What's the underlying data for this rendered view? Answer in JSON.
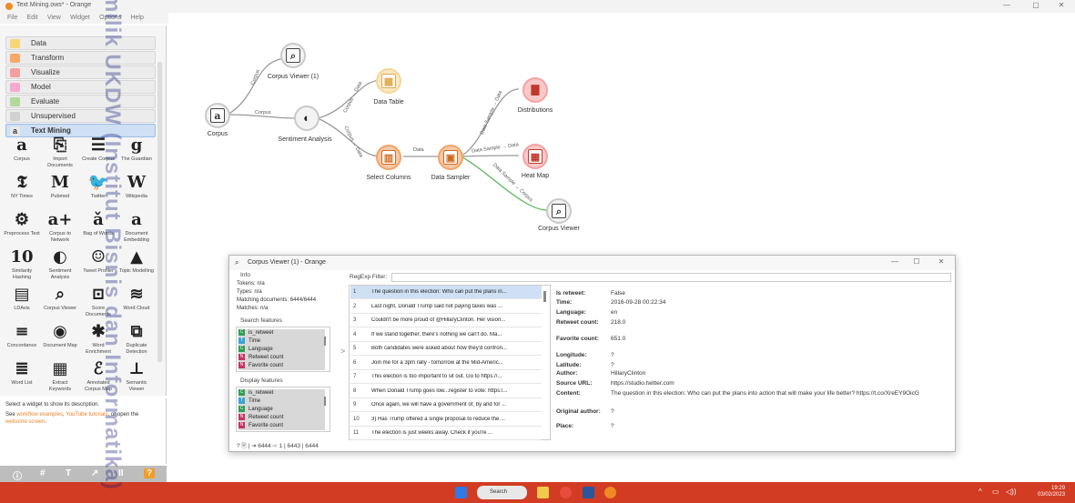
{
  "window": {
    "title": "Text Mining.ows* - Orange",
    "menu": [
      "File",
      "Edit",
      "View",
      "Widget",
      "Options",
      "Help"
    ]
  },
  "toolbox": {
    "categories": [
      {
        "label": "Data",
        "color": "#f7d775"
      },
      {
        "label": "Transform",
        "color": "#f7a96c"
      },
      {
        "label": "Visualize",
        "color": "#f49f9f"
      },
      {
        "label": "Model",
        "color": "#f7a8d1"
      },
      {
        "label": "Evaluate",
        "color": "#b2d99a"
      },
      {
        "label": "Unsupervised",
        "color": "#d0d0d0"
      },
      {
        "label": "Text Mining",
        "color": "#e9e9e9"
      }
    ],
    "widgets": [
      {
        "label": "Corpus",
        "icon": "a"
      },
      {
        "label": "Import Documents",
        "icon": "⎘"
      },
      {
        "label": "Create Corpus",
        "icon": "☰"
      },
      {
        "label": "The Guardian",
        "icon": "g"
      },
      {
        "label": "NY Times",
        "icon": "𝕿"
      },
      {
        "label": "Pubmed",
        "icon": "M"
      },
      {
        "label": "Twitter",
        "icon": "🐦"
      },
      {
        "label": "Wikipedia",
        "icon": "W"
      },
      {
        "label": "Preprocess Text",
        "icon": "⚙"
      },
      {
        "label": "Corpus to Network",
        "icon": "a+"
      },
      {
        "label": "Bag of Words",
        "icon": "ǎ"
      },
      {
        "label": "Document Embedding",
        "icon": "a"
      },
      {
        "label": "Similarity Hashing",
        "icon": "10"
      },
      {
        "label": "Sentiment Analysis",
        "icon": "◐"
      },
      {
        "label": "Tweet Profiler",
        "icon": "☺"
      },
      {
        "label": "Topic Modelling",
        "icon": "▲"
      },
      {
        "label": "LDAvis",
        "icon": "▤"
      },
      {
        "label": "Corpus Viewer",
        "icon": "⌕"
      },
      {
        "label": "Score Documents",
        "icon": "⊡"
      },
      {
        "label": "Word Cloud",
        "icon": "≋"
      },
      {
        "label": "Concordance",
        "icon": "≡"
      },
      {
        "label": "Document Map",
        "icon": "◉"
      },
      {
        "label": "Word Enrichment",
        "icon": "✱"
      },
      {
        "label": "Duplicate Detection",
        "icon": "⧉"
      },
      {
        "label": "Word List",
        "icon": "≣"
      },
      {
        "label": "Extract Keywords",
        "icon": "▦"
      },
      {
        "label": "Annotated Corpus Map",
        "icon": "ℰ"
      },
      {
        "label": "Semantic Viewer",
        "icon": "⊥"
      }
    ]
  },
  "description": {
    "line1": "Select a widget to show its description.",
    "line2a": "See ",
    "link1": "workflow examples",
    "line2b": ", ",
    "link2": "YouTube tutorials",
    "line2c": ", or open the",
    "link3": "welcome screen",
    "line2d": "."
  },
  "bottom_toolbar": [
    "ⓘ",
    "#",
    "T",
    "↗",
    "II",
    "?"
  ],
  "canvas": {
    "nodes": [
      {
        "label": "Corpus",
        "icon": "a"
      },
      {
        "label": "Corpus Viewer (1)",
        "icon": "⌕"
      },
      {
        "label": "Sentiment Analysis",
        "icon": "◐"
      },
      {
        "label": "Data Table",
        "icon": "▦"
      },
      {
        "label": "Select Columns",
        "icon": "▥"
      },
      {
        "label": "Data Sampler",
        "icon": "▣"
      },
      {
        "label": "Distributions",
        "icon": "▇"
      },
      {
        "label": "Heat Map",
        "icon": "▦"
      },
      {
        "label": "Corpus Viewer",
        "icon": "⌕"
      }
    ],
    "edges": [
      "Corpus",
      "Corpus",
      "Corpus → Data",
      "Corpus → Data",
      "Data",
      "Data Sample → Data",
      "Data Sample → Data",
      "Data Sample → Corpus"
    ]
  },
  "corpus_viewer": {
    "title": "Corpus Viewer (1) - Orange",
    "info_title": "Info",
    "info": [
      "Tokens: n/a",
      "Types: n/a",
      "Matching documents: 6444/6444",
      "Matches: n/a"
    ],
    "search_title": "Search features",
    "search_features": [
      {
        "label": "is_retweet",
        "badge": "C",
        "color": "#2e9e53"
      },
      {
        "label": "Time",
        "badge": "T",
        "color": "#3aa3d6"
      },
      {
        "label": "Language",
        "badge": "C",
        "color": "#2e9e53"
      },
      {
        "label": "Retweet count",
        "badge": "N",
        "color": "#c43561"
      },
      {
        "label": "Favorite count",
        "badge": "N",
        "color": "#c43561"
      }
    ],
    "display_title": "Display features",
    "display_features": [
      {
        "label": "is_retweet",
        "badge": "C",
        "color": "#2e9e53"
      },
      {
        "label": "Time",
        "badge": "T",
        "color": "#3aa3d6"
      },
      {
        "label": "Language",
        "badge": "C",
        "color": "#2e9e53"
      },
      {
        "label": "Retweet count",
        "badge": "N",
        "color": "#c43561"
      },
      {
        "label": "Favorite count",
        "badge": "N",
        "color": "#c43561"
      }
    ],
    "regexp_label": "RegExp Filter:",
    "rows": [
      {
        "n": "1",
        "text": "The question in this election: Who can put the plans in..."
      },
      {
        "n": "2",
        "text": "Last night, Donald Trump said not paying taxes was ..."
      },
      {
        "n": "3",
        "text": "Couldn't be more proud of @HillaryClinton. Her vision..."
      },
      {
        "n": "4",
        "text": "If we stand together, there's nothing we can't do.   Ma..."
      },
      {
        "n": "5",
        "text": "Both candidates were asked about how they'd confron..."
      },
      {
        "n": "6",
        "text": "Join me for a 3pm rally - tomorrow at the Mid-Americ..."
      },
      {
        "n": "7",
        "text": "This election is too important to sit out. Go to https://..."
      },
      {
        "n": "8",
        "text": "When Donald Trump goes low...register to vote: https:/..."
      },
      {
        "n": "9",
        "text": "Once again, we will have a government of, by and for ..."
      },
      {
        "n": "10",
        "text": "3) Has Trump offered a single proposal to reduce the ..."
      },
      {
        "n": "11",
        "text": "The election is just weeks away. Check if you're ..."
      }
    ],
    "meta": [
      {
        "k": "Is retweet:",
        "v": "False"
      },
      {
        "k": "Time:",
        "v": "2016-09-28 00:22:34"
      },
      {
        "k": "Language:",
        "v": "en"
      },
      {
        "k": "Retweet count:",
        "v": "218.0"
      },
      {
        "k": "Favorite count:",
        "v": "651.0"
      },
      {
        "k": "Longitude:",
        "v": "?"
      },
      {
        "k": "Latitude:",
        "v": "?"
      },
      {
        "k": "Author:",
        "v": "HillaryClinton"
      },
      {
        "k": "Source URL:",
        "v": "https://studio.twitter.com"
      },
      {
        "k": "Content:",
        "v": "The question in this election: Who can put the plans into action that will make your life better? https://t.co/XreEY9OicG"
      },
      {
        "k": "Original author:",
        "v": "?"
      },
      {
        "k": "Place:",
        "v": "?"
      }
    ],
    "status": "? 🖹 | ⇥ 6444 ⇨ 1 | 6443 | 6444"
  },
  "taskbar": {
    "search": "Search",
    "time": "19:29",
    "date": "03/02/2023"
  },
  "watermark": "milik UKDW (Institut Bisnis dan Informatika)"
}
